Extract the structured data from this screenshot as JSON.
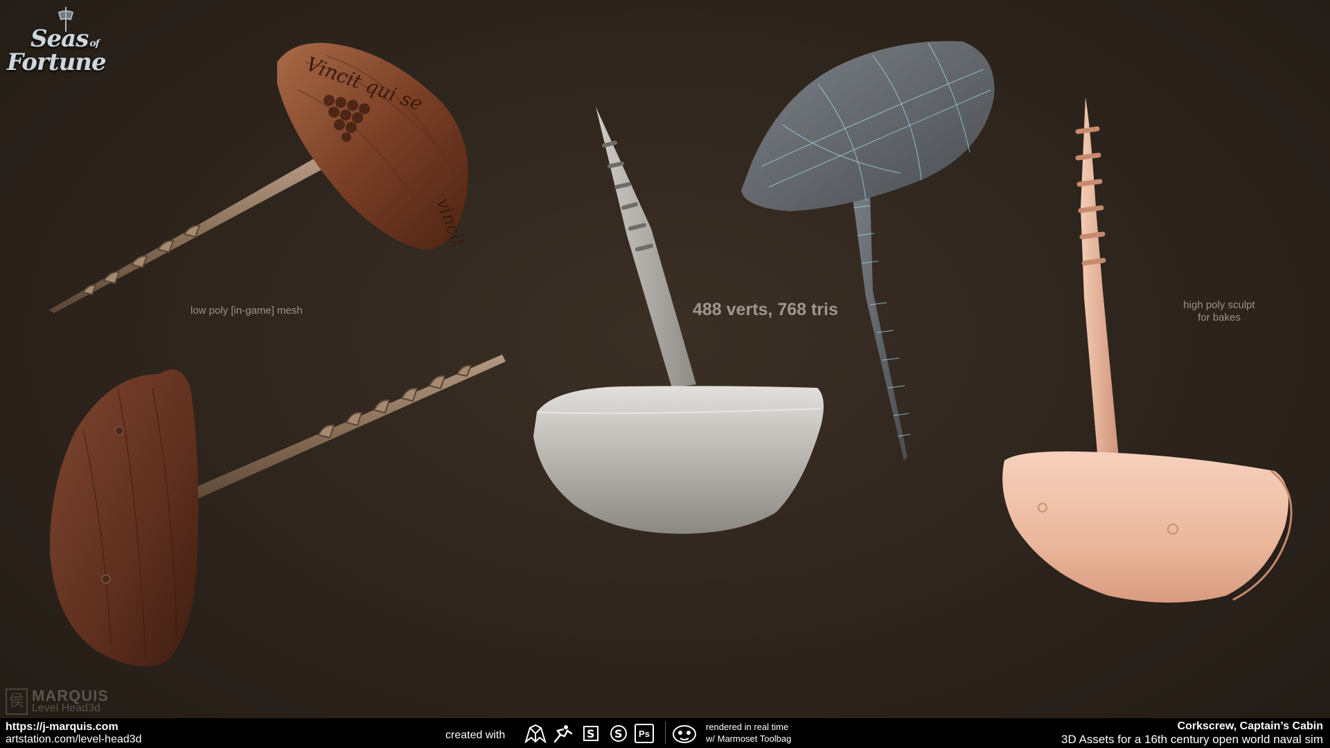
{
  "logo": {
    "line1": "Seas",
    "line1_small": "of",
    "line2": "Fortune"
  },
  "captions": {
    "low_poly": "low poly [in-game] mesh",
    "stats": "488 verts, 768 tris",
    "high_poly_line1": "high poly sculpt",
    "high_poly_line2": "for bakes"
  },
  "engraving": {
    "text1": "Vincit qui se",
    "text2": "vincit"
  },
  "watermark": {
    "glyph": "侯",
    "name": "MARQUIS",
    "sub": "Level Head3d"
  },
  "footer": {
    "website": "https://j-marquis.com",
    "artstation": "artstation.com/level-head3d",
    "created_with": "created with",
    "tools": [
      "3ds-max-icon",
      "zbrush-icon",
      "substance-designer-icon",
      "substance-painter-icon",
      "photoshop-icon"
    ],
    "ps_label": "Ps",
    "rendered_line1": "rendered in real time",
    "rendered_line2": "w/ Marmoset Toolbag",
    "title": "Corkscrew, Captain’s Cabin",
    "subtitle": "3D Assets for a 16th century open world naval sim"
  },
  "colors": {
    "wood_dark": "#5a2e1c",
    "wood_light": "#8b5235",
    "clay_grey": "#a9a6a2",
    "wire_grey": "#5f6468",
    "wire_line": "#9fd6e6",
    "sculpt_pink": "#f0c2aa"
  }
}
